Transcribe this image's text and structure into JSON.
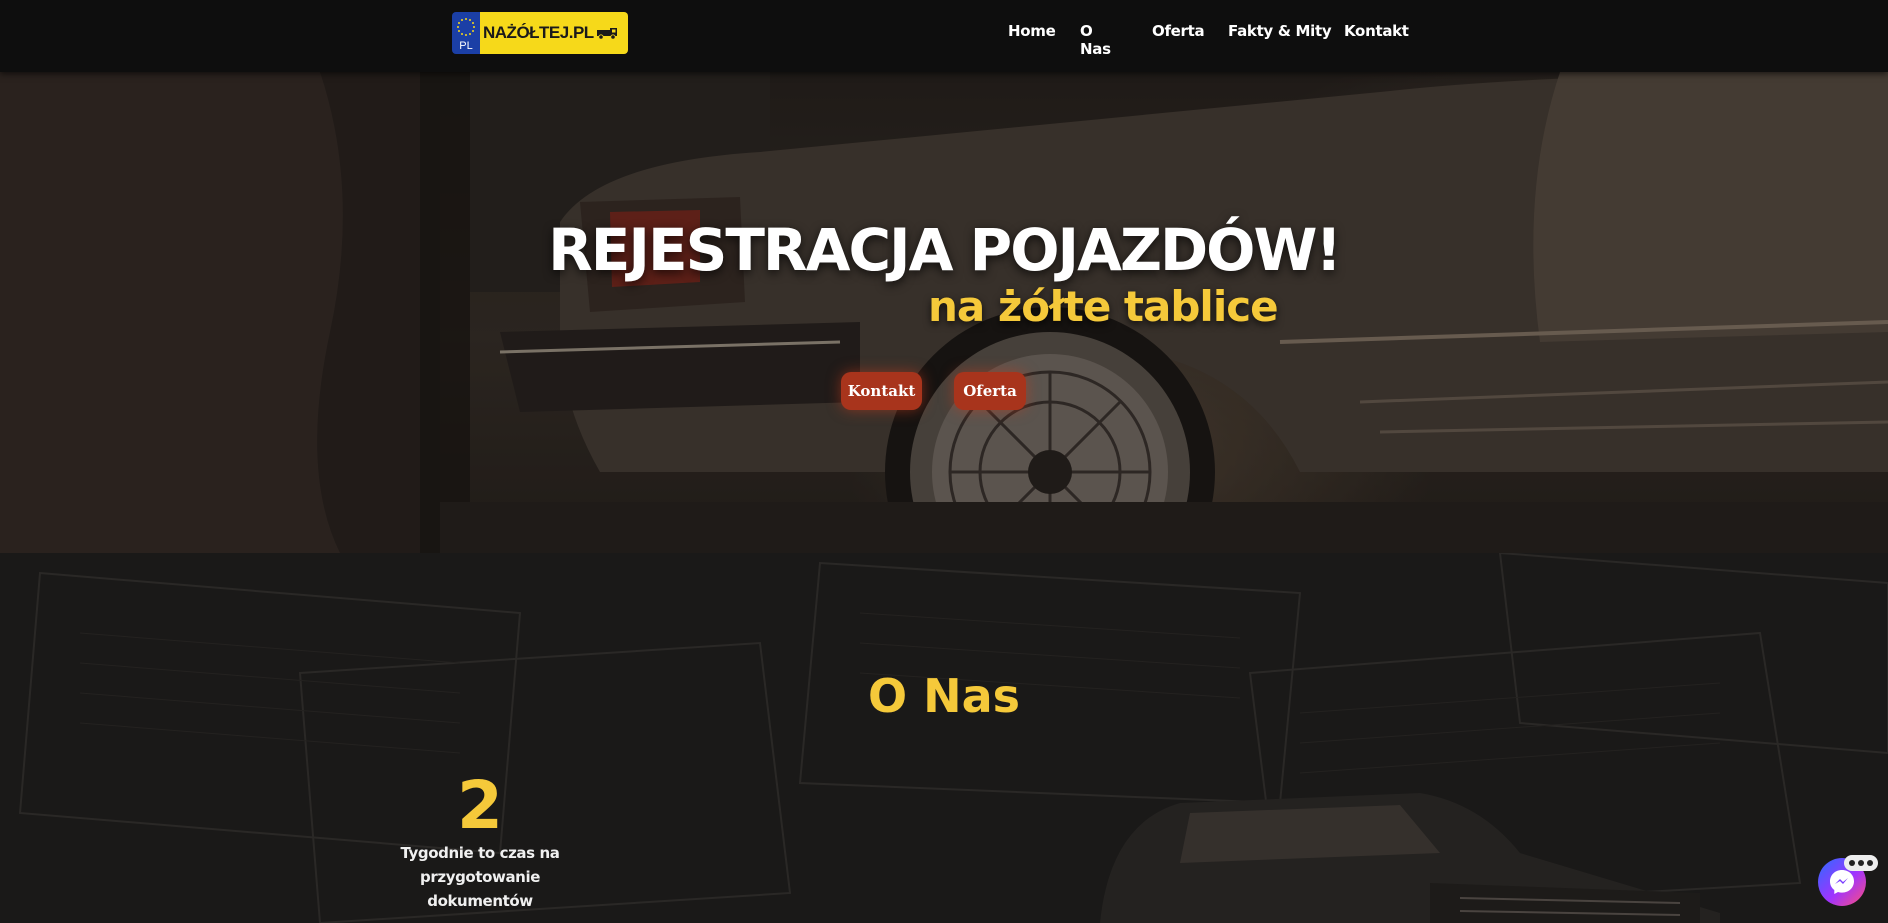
{
  "header": {
    "logo": {
      "country_code": "PL",
      "text": "NAŻÓŁTEJ.PL"
    },
    "nav": [
      {
        "label": "Home"
      },
      {
        "label": "O Nas"
      },
      {
        "label": "Oferta"
      },
      {
        "label": "Fakty & Mity"
      },
      {
        "label": "Kontakt"
      }
    ]
  },
  "hero": {
    "title": "REJESTRACJA POJAZDÓW!",
    "subtitle": "na żółte tablice",
    "buttons": [
      {
        "label": "Kontakt"
      },
      {
        "label": "Oferta"
      }
    ]
  },
  "about": {
    "title": "O Nas",
    "stat": {
      "number": "2",
      "description": "Tygodnie to czas na przygotowanie dokumentów"
    }
  },
  "chat_widget": {
    "icon": "messenger-icon"
  },
  "colors": {
    "accent_yellow": "#f5c93a",
    "button_red": "#a8341c",
    "nav_bg": "#0e0e0e"
  }
}
